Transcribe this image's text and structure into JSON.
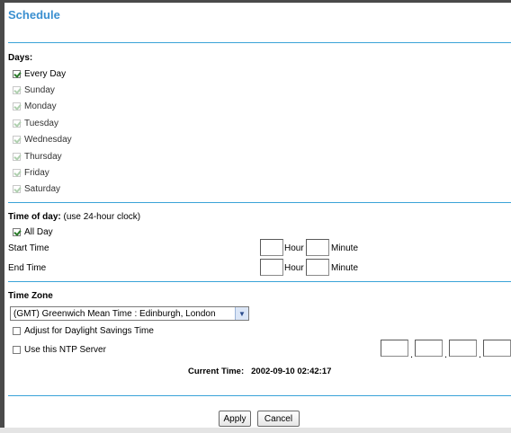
{
  "page": {
    "title": "Schedule"
  },
  "days": {
    "heading": "Days:",
    "items": [
      {
        "label": "Every Day",
        "checked": true,
        "disabled": false
      },
      {
        "label": "Sunday",
        "checked": true,
        "disabled": true
      },
      {
        "label": "Monday",
        "checked": true,
        "disabled": true
      },
      {
        "label": "Tuesday",
        "checked": true,
        "disabled": true
      },
      {
        "label": "Wednesday",
        "checked": true,
        "disabled": true
      },
      {
        "label": "Thursday",
        "checked": true,
        "disabled": true
      },
      {
        "label": "Friday",
        "checked": true,
        "disabled": true
      },
      {
        "label": "Saturday",
        "checked": true,
        "disabled": true
      }
    ]
  },
  "time_of_day": {
    "heading": "Time of day:",
    "note": " (use 24-hour clock)",
    "all_day_label": "All Day",
    "all_day_checked": true,
    "start_label": "Start Time",
    "end_label": "End Time",
    "hour_label": "Hour",
    "minute_label": "Minute",
    "start_hour": "",
    "start_minute": "",
    "end_hour": "",
    "end_minute": ""
  },
  "time_zone": {
    "heading": "Time Zone",
    "selected": "(GMT) Greenwich Mean Time : Edinburgh, London",
    "daylight_label": "Adjust for Daylight Savings Time",
    "daylight_checked": false,
    "ntp_label": "Use this NTP Server",
    "ntp_checked": false,
    "ntp_octets": [
      "",
      "",
      "",
      ""
    ],
    "current_time_label": "Current Time:",
    "current_time_value": "2002-09-10 02:42:17"
  },
  "buttons": {
    "apply": "Apply",
    "cancel": "Cancel"
  }
}
